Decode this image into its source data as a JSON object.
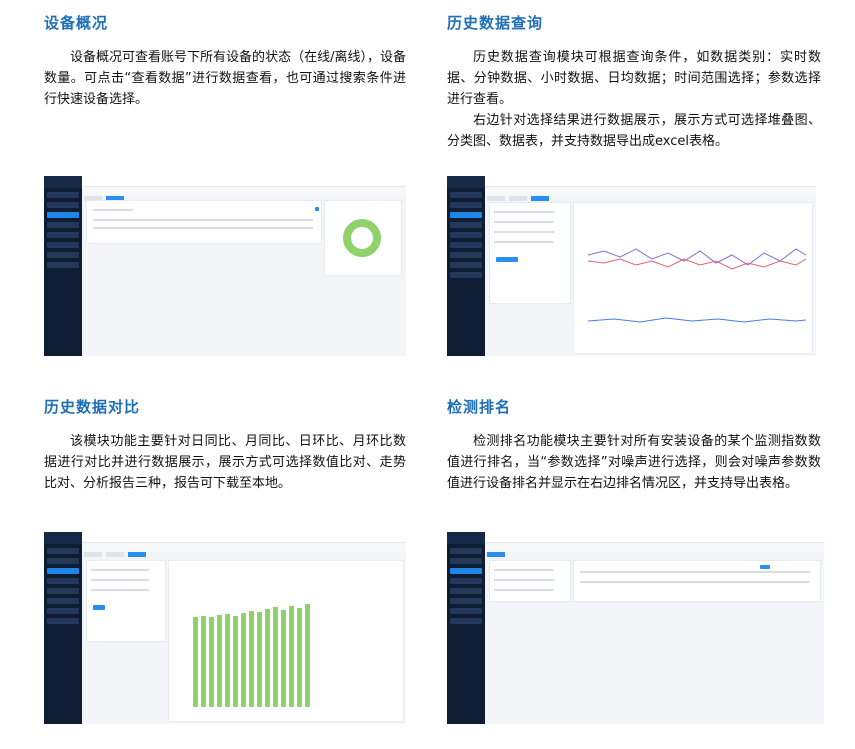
{
  "sections": [
    {
      "title": "设备概况",
      "paragraphs": [
        "设备概况可查看账号下所有设备的状态（在线/离线），设备数量。可点击“查看数据”进行数据查看，也可通过搜索条件进行快速设备选择。"
      ]
    },
    {
      "title": "历史数据查询",
      "paragraphs": [
        "历史数据查询模块可根据查询条件，如数据类别：实时数据、分钟数据、小时数据、日均数据；时间范围选择；参数选择进行查看。",
        "右边针对选择结果进行数据展示，展示方式可选择堆叠图、分类图、数据表，并支持数据导出成excel表格。"
      ]
    },
    {
      "title": "历史数据对比",
      "paragraphs": [
        "该模块功能主要针对日同比、月同比、日环比、月环比数据进行对比并进行数据展示，展示方式可选择数值比对、走势比对、分析报告三种，报告可下载至本地。"
      ]
    },
    {
      "title": "检测排名",
      "paragraphs": [
        "检测排名功能模块主要针对所有安装设备的某个监测指数数值进行排名，当“参数选择”对噪声进行选择，则会对噪声参数数值进行设备排名并显示在右边排名情况区，并支持导出表格。"
      ]
    }
  ],
  "colors": {
    "title": "#1d6fb8",
    "sidebar": "#0e1d33",
    "accent": "#2a8ef0",
    "donut": "#8fd16d",
    "bars": "#8fd16d"
  }
}
